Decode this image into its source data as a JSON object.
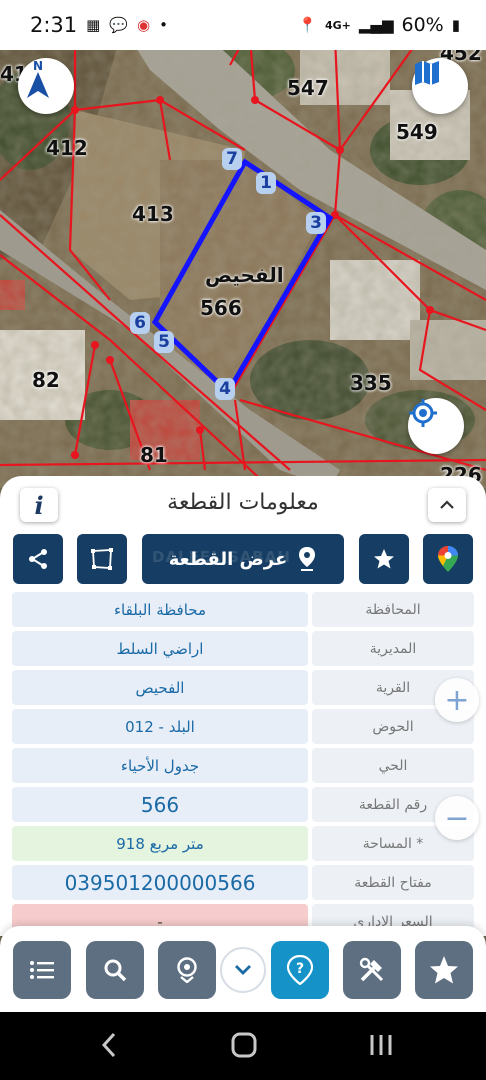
{
  "status_bar": {
    "time": "2:31",
    "network": "4G+",
    "battery": "60%"
  },
  "map": {
    "parcel_numbers": [
      "41",
      "452",
      "547",
      "412",
      "549",
      "413",
      "566",
      "82",
      "335",
      "81",
      "226"
    ],
    "area_name": "الفحيص",
    "vertex_labels": [
      "1",
      "3",
      "4",
      "5",
      "6",
      "7"
    ],
    "compass_letter": "N"
  },
  "sheet": {
    "title": "معلومات القطعة",
    "show_parcel_label": "عرض القطعة",
    "watermark": "DALEEL SABAH",
    "rows": [
      {
        "label": "المحافظة",
        "value": "محافظة البلقاء"
      },
      {
        "label": "المديرية",
        "value": "اراضي السلط"
      },
      {
        "label": "القرية",
        "value": "الفحيص"
      },
      {
        "label": "الحوض",
        "value": "البلد - 012"
      },
      {
        "label": "الحي",
        "value": "جدول الأحياء"
      },
      {
        "label": "رقم القطعة",
        "value": "566"
      },
      {
        "label": "المساحة *",
        "value": "918  متر مربع"
      },
      {
        "label": "مفتاح القطعة",
        "value": "039501200000566"
      },
      {
        "label": "السعر الإداري",
        "value": "-"
      }
    ],
    "zoom_in": "+",
    "zoom_out": "−"
  },
  "colors": {
    "navy": "#163e64",
    "active": "#1593c8",
    "parcel_outline": "#1414ff",
    "boundary": "#e8141e"
  }
}
